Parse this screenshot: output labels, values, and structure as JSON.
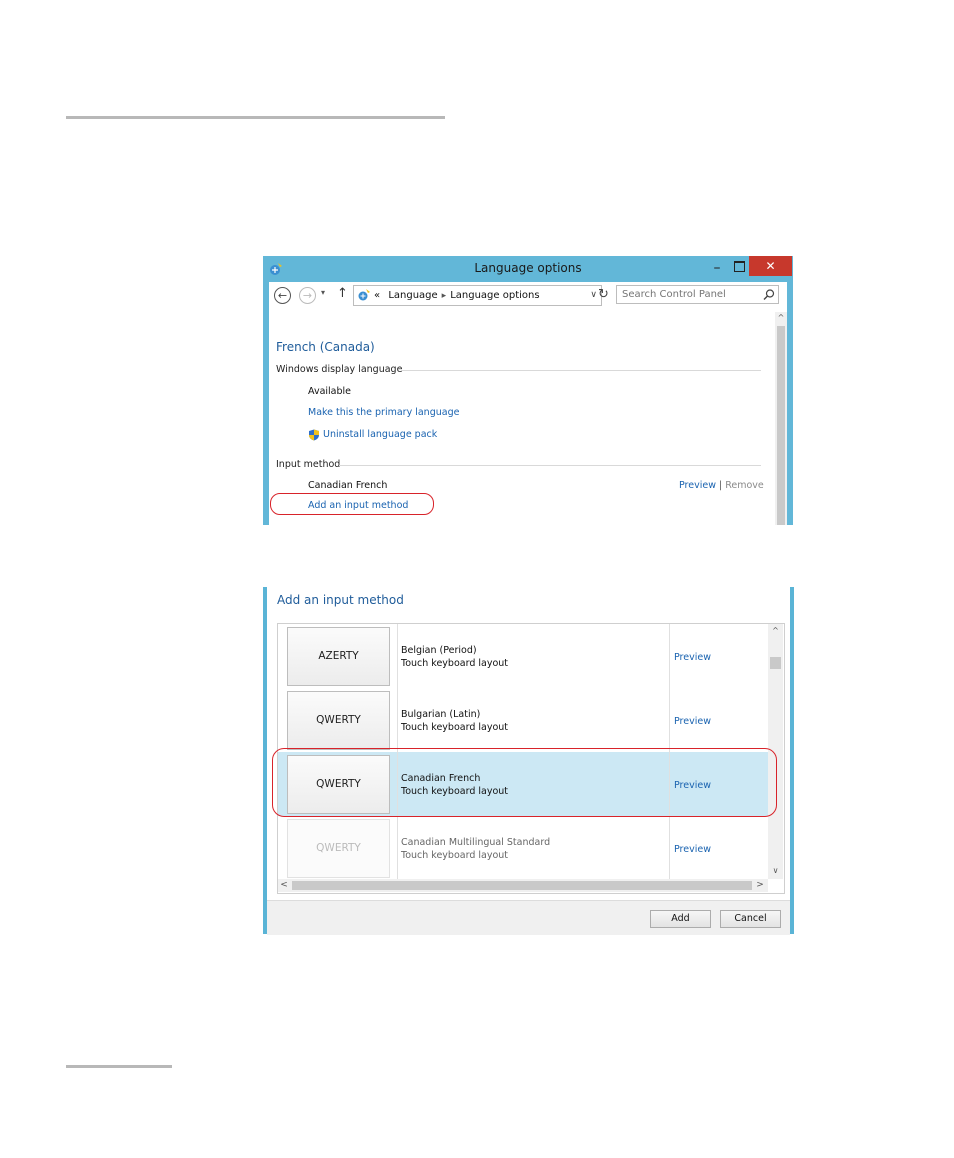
{
  "window": {
    "title": "Language options",
    "minimize": "–",
    "close": "✕",
    "nav": {
      "back": "←",
      "forward": "→",
      "recent": "▾",
      "up": "↑",
      "breadcrumb_prefix": "«",
      "breadcrumb": [
        "Language",
        "Language options"
      ],
      "dropdown": "∨",
      "refresh": "↻",
      "search_placeholder": "Search Control Panel"
    },
    "scroll_up": "^",
    "language_name": "French (Canada)",
    "display_section": {
      "label": "Windows display language",
      "status": "Available",
      "make_primary_link": "Make this the primary language",
      "uninstall_link": "Uninstall language pack"
    },
    "input_section": {
      "label": "Input method",
      "method": "Canadian French",
      "preview_link": "Preview",
      "separator": "|",
      "remove_link": "Remove",
      "add_link": "Add an input method"
    }
  },
  "dialog": {
    "title": "Add an input method",
    "rows": [
      {
        "keyboard": "AZERTY",
        "name": "Belgian (Period)",
        "subtitle": "Touch keyboard layout",
        "preview": "Preview"
      },
      {
        "keyboard": "QWERTY",
        "name": "Bulgarian (Latin)",
        "subtitle": "Touch keyboard layout",
        "preview": "Preview"
      },
      {
        "keyboard": "QWERTY",
        "name": "Canadian French",
        "subtitle": "Touch keyboard layout",
        "preview": "Preview"
      },
      {
        "keyboard": "QWERTY",
        "name": "Canadian Multilingual Standard",
        "subtitle": "Touch keyboard layout",
        "preview": "Preview"
      }
    ],
    "scroll": {
      "up": "^",
      "down": "∨",
      "left": "<",
      "right": ">"
    },
    "add_button": "Add",
    "cancel_button": "Cancel"
  },
  "colors": {
    "window_frame": "#62b7d8",
    "close_button": "#c7382c",
    "link": "#1a63b0",
    "heading": "#1f5c9a",
    "selected_row": "#cce8f4",
    "highlight": "#d8232a"
  }
}
